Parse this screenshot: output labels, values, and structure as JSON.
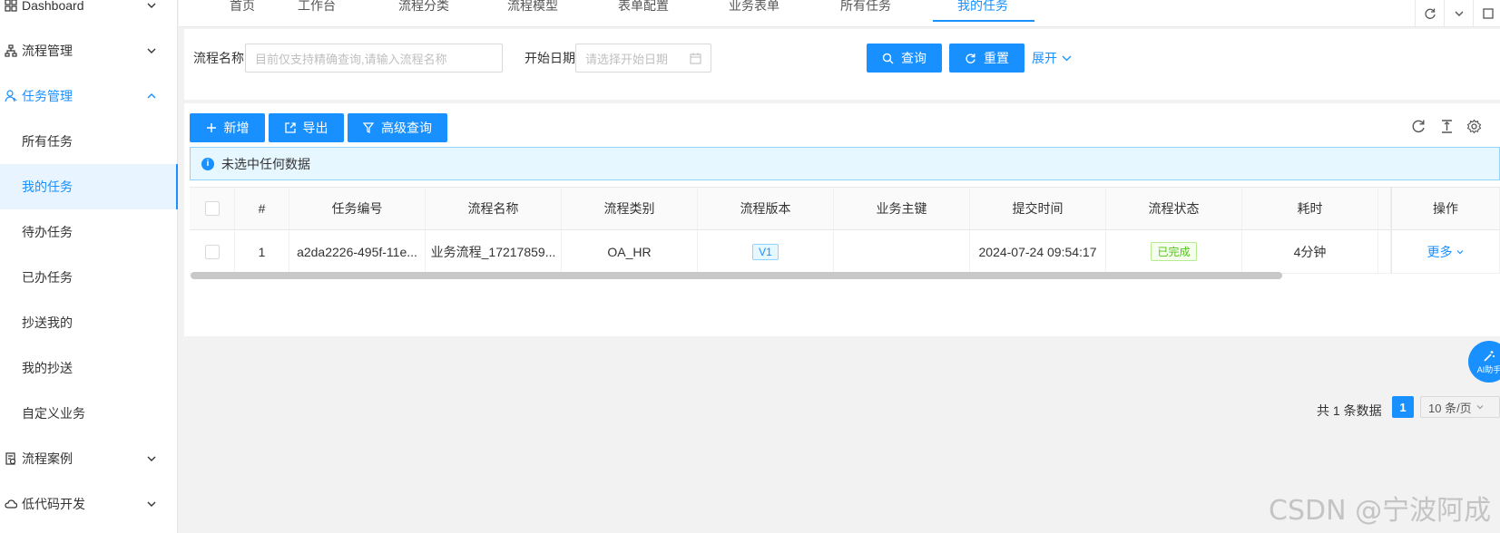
{
  "sidebar": {
    "items": [
      {
        "label": "Dashboard",
        "icon": "grid-icon"
      },
      {
        "label": "流程管理",
        "icon": "org-chart-icon"
      },
      {
        "label": "任务管理",
        "icon": "user-task-icon"
      },
      {
        "label": "流程案例",
        "icon": "document-icon"
      },
      {
        "label": "低代码开发",
        "icon": "cloud-icon"
      }
    ],
    "sub_items": [
      "所有任务",
      "我的任务",
      "待办任务",
      "已办任务",
      "抄送我的",
      "我的抄送",
      "自定义业务"
    ],
    "selected": "我的任务"
  },
  "tabs": [
    "首页",
    "工作台",
    "流程分类",
    "流程模型",
    "表单配置",
    "业务表单",
    "所有任务",
    "我的任务"
  ],
  "active_tab": "我的任务",
  "search": {
    "name_label": "流程名称",
    "name_placeholder": "目前仅支持精确查询,请输入流程名称",
    "date_label": "开始日期",
    "date_placeholder": "请选择开始日期",
    "query_label": "查询",
    "reset_label": "重置",
    "expand_label": "展开"
  },
  "toolbar": {
    "add_label": "新增",
    "export_label": "导出",
    "advanced_label": "高级查询"
  },
  "info_text": "未选中任何数据",
  "table": {
    "columns": [
      "#",
      "任务编号",
      "流程名称",
      "流程类别",
      "流程版本",
      "业务主键",
      "提交时间",
      "流程状态",
      "耗时",
      "操作"
    ],
    "rows": [
      {
        "index": "1",
        "task_no": "a2da2226-495f-11e...",
        "process_name": "业务流程_17217859...",
        "category": "OA_HR",
        "version": "V1",
        "biz_key": "",
        "submit_time": "2024-07-24 09:54:17",
        "status": "已完成",
        "duration": "4分钟",
        "action": "更多"
      }
    ]
  },
  "pagination": {
    "total_text": "共 1 条数据",
    "current_page": "1",
    "page_size": "10 条/页"
  },
  "ai_button_label": "AI助手",
  "watermark": "CSDN @宁波阿成",
  "colors": {
    "accent": "#1890ff",
    "success": "#52c41a",
    "info_bg": "#e6f7ff"
  }
}
